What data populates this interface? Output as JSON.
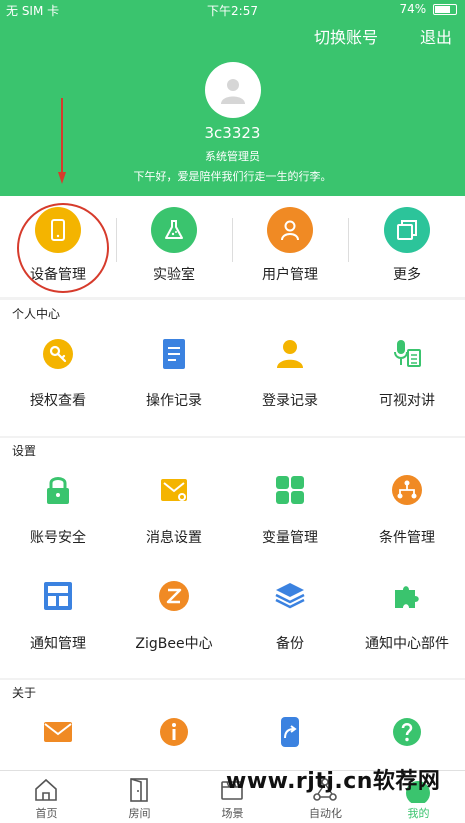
{
  "status_bar": {
    "carrier": "无 SIM 卡",
    "time": "下午2:57",
    "battery_percent": "74%",
    "battery_level": 0.74
  },
  "header": {
    "switch_account": "切换账号",
    "logout": "退出",
    "username": "3c3323",
    "role": "系统管理员",
    "greeting": "下午好，爱是陪伴我们行走一生的行李。"
  },
  "quick_actions": [
    {
      "label": "设备管理",
      "icon": "phone-icon",
      "color": "#f4b400"
    },
    {
      "label": "实验室",
      "icon": "flask-icon",
      "color": "#3ac46e"
    },
    {
      "label": "用户管理",
      "icon": "user-icon",
      "color": "#f08a24"
    },
    {
      "label": "更多",
      "icon": "stack-icon",
      "color": "#2cc49a"
    }
  ],
  "sections": [
    {
      "title": "个人中心",
      "items": [
        {
          "label": "授权查看",
          "icon": "key-icon",
          "color": "#f4b400"
        },
        {
          "label": "操作记录",
          "icon": "document-icon",
          "color": "#3b82e0"
        },
        {
          "label": "登录记录",
          "icon": "person-icon",
          "color": "#f4b400"
        },
        {
          "label": "可视对讲",
          "icon": "intercom-icon",
          "color": "#3ac46e"
        }
      ]
    },
    {
      "title": "设置",
      "items": [
        {
          "label": "账号安全",
          "icon": "lock-icon",
          "color": "#3ac46e"
        },
        {
          "label": "消息设置",
          "icon": "message-settings-icon",
          "color": "#f4b400"
        },
        {
          "label": "变量管理",
          "icon": "grid-icon",
          "color": "#3ac46e"
        },
        {
          "label": "条件管理",
          "icon": "tree-icon",
          "color": "#f08a24"
        },
        {
          "label": "通知管理",
          "icon": "layout-icon",
          "color": "#3b82e0"
        },
        {
          "label": "ZigBee中心",
          "icon": "zigbee-icon",
          "color": "#f08a24"
        },
        {
          "label": "备份",
          "icon": "layers-icon",
          "color": "#3b82e0"
        },
        {
          "label": "通知中心部件",
          "icon": "puzzle-icon",
          "color": "#3ac46e"
        }
      ]
    },
    {
      "title": "关于",
      "items": [
        {
          "label": "",
          "icon": "mail-icon",
          "color": "#f08a24"
        },
        {
          "label": "",
          "icon": "info-icon",
          "color": "#f08a24"
        },
        {
          "label": "",
          "icon": "share-icon",
          "color": "#3b82e0"
        },
        {
          "label": "",
          "icon": "help-icon",
          "color": "#3ac46e"
        }
      ]
    }
  ],
  "tabs": [
    {
      "label": "首页",
      "icon": "home-icon"
    },
    {
      "label": "房间",
      "icon": "door-icon"
    },
    {
      "label": "场景",
      "icon": "scene-icon"
    },
    {
      "label": "自动化",
      "icon": "automation-icon"
    },
    {
      "label": "我的",
      "icon": "me-icon",
      "active": true
    }
  ],
  "watermark": "www.rjtj.cn软荐网",
  "colors": {
    "primary": "#3ac46e",
    "annotation": "#d63b2c"
  }
}
